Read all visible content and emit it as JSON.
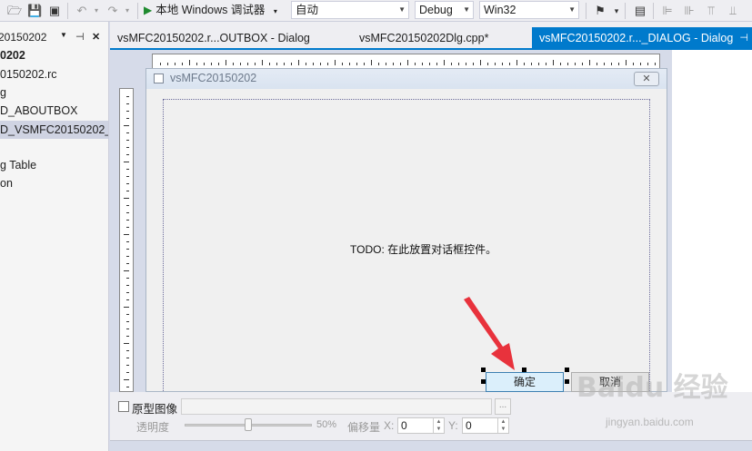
{
  "toolbar": {
    "run_label": "本地 Windows 调试器",
    "config_combo": "自动",
    "build_combo": "Debug",
    "platform_combo": "Win32"
  },
  "explorer": {
    "title_fragment": "20150202",
    "items": [
      {
        "label": "0202",
        "bold": true
      },
      {
        "label": "0150202.rc"
      },
      {
        "label": "g"
      },
      {
        "label": "D_ABOUTBOX"
      },
      {
        "label": "D_VSMFC20150202_",
        "selected": true
      },
      {
        "label": "g Table"
      },
      {
        "label": "on"
      }
    ]
  },
  "tabs": [
    {
      "label": "vsMFC20150202.r...OUTBOX - Dialog"
    },
    {
      "label": "vsMFC20150202Dlg.cpp*"
    },
    {
      "label": "vsMFC20150202.r..._DIALOG - Dialog",
      "active": true
    }
  ],
  "dialog": {
    "title": "vsMFC20150202",
    "todo_text": "TODO: 在此放置对话框控件。",
    "ok_label": "确定",
    "cancel_label": "取消"
  },
  "bottom": {
    "prototype_label": "原型图像",
    "browse_label": "...",
    "opacity_label": "透明度",
    "opacity_value": "50%",
    "opacity_fraction": 0.5,
    "offset_label": "偏移量",
    "x_label": "X:",
    "x_value": "0",
    "y_label": "Y:",
    "y_value": "0"
  },
  "watermark": {
    "brand": "Baidu 经验",
    "url": "jingyan.baidu.com"
  },
  "colors": {
    "accent": "#007acc",
    "arrow": "#e8323c"
  }
}
